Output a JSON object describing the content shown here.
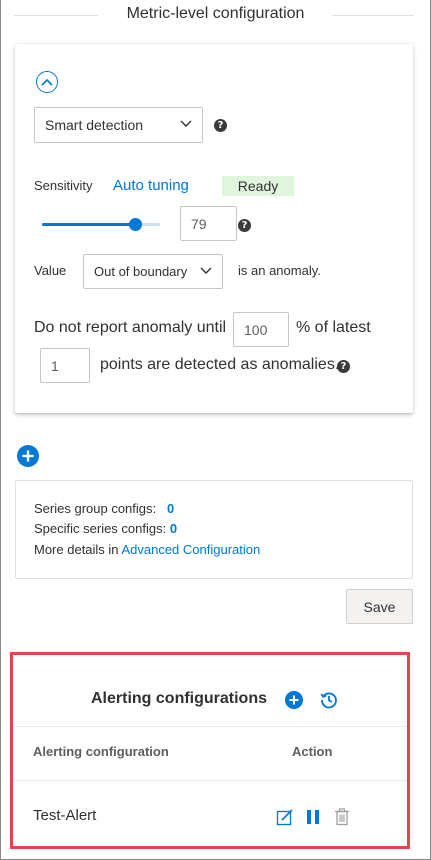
{
  "section": {
    "title": "Metric-level configuration"
  },
  "detection": {
    "method": "Smart detection",
    "sensitivity_label": "Sensitivity",
    "auto_tuning_label": "Auto tuning",
    "status_badge": "Ready",
    "sensitivity_value": "79",
    "sensitivity_level": 0.79,
    "value_label": "Value",
    "boundary_option": "Out of boundary",
    "anomaly_suffix": "is an anomaly.",
    "do_not_report_prefix": "Do not report anomaly until",
    "percent_value": "100",
    "percent_suffix": "% of latest",
    "points_value": "1",
    "points_suffix": "points are detected as anomalies."
  },
  "summary": {
    "series_group_label": "Series group configs:",
    "series_group_count": "0",
    "specific_series_label": "Specific series configs:",
    "specific_series_count": "0",
    "more_details_prefix": "More details in",
    "advanced_link": "Advanced Configuration"
  },
  "actions": {
    "save_label": "Save"
  },
  "alerting": {
    "title": "Alerting configurations",
    "columns": [
      "Alerting configuration",
      "Action"
    ],
    "rows": [
      {
        "name": "Test-Alert"
      }
    ]
  },
  "colors": {
    "accent": "#0078d4",
    "ready_bg": "#dff6dd",
    "highlight_border": "#e8424d"
  },
  "icons": {
    "collapse": "chevron-up-circle-icon",
    "help": "question-circle-icon",
    "add": "add-circle-icon",
    "history": "history-icon",
    "edit": "edit-icon",
    "pause": "pause-icon",
    "delete": "delete-icon"
  }
}
